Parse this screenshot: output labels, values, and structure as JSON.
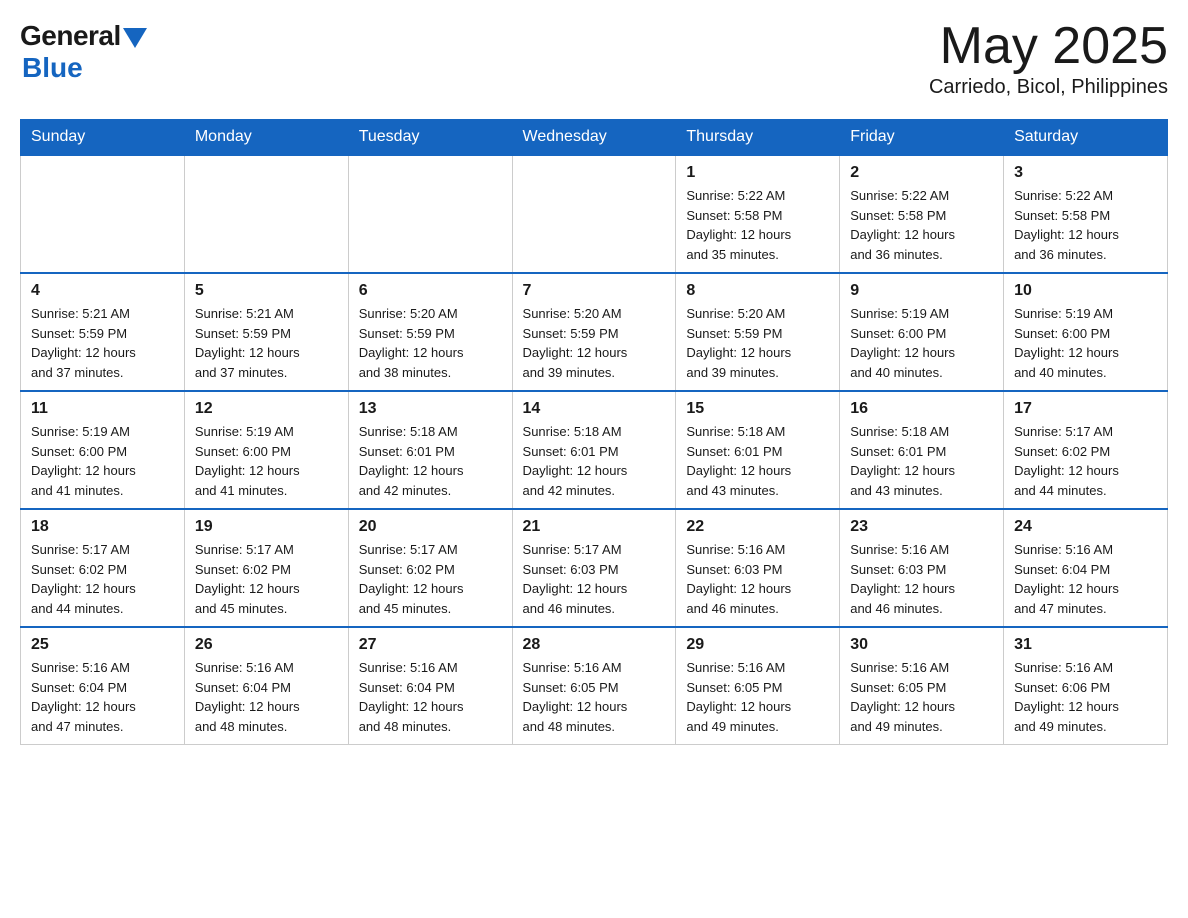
{
  "header": {
    "logo": {
      "general": "General",
      "blue": "Blue",
      "subtitle": "Blue"
    },
    "month": "May 2025",
    "location": "Carriedo, Bicol, Philippines"
  },
  "days_of_week": [
    "Sunday",
    "Monday",
    "Tuesday",
    "Wednesday",
    "Thursday",
    "Friday",
    "Saturday"
  ],
  "weeks": [
    {
      "days": [
        {
          "number": "",
          "info": ""
        },
        {
          "number": "",
          "info": ""
        },
        {
          "number": "",
          "info": ""
        },
        {
          "number": "",
          "info": ""
        },
        {
          "number": "1",
          "info": "Sunrise: 5:22 AM\nSunset: 5:58 PM\nDaylight: 12 hours\nand 35 minutes."
        },
        {
          "number": "2",
          "info": "Sunrise: 5:22 AM\nSunset: 5:58 PM\nDaylight: 12 hours\nand 36 minutes."
        },
        {
          "number": "3",
          "info": "Sunrise: 5:22 AM\nSunset: 5:58 PM\nDaylight: 12 hours\nand 36 minutes."
        }
      ]
    },
    {
      "days": [
        {
          "number": "4",
          "info": "Sunrise: 5:21 AM\nSunset: 5:59 PM\nDaylight: 12 hours\nand 37 minutes."
        },
        {
          "number": "5",
          "info": "Sunrise: 5:21 AM\nSunset: 5:59 PM\nDaylight: 12 hours\nand 37 minutes."
        },
        {
          "number": "6",
          "info": "Sunrise: 5:20 AM\nSunset: 5:59 PM\nDaylight: 12 hours\nand 38 minutes."
        },
        {
          "number": "7",
          "info": "Sunrise: 5:20 AM\nSunset: 5:59 PM\nDaylight: 12 hours\nand 39 minutes."
        },
        {
          "number": "8",
          "info": "Sunrise: 5:20 AM\nSunset: 5:59 PM\nDaylight: 12 hours\nand 39 minutes."
        },
        {
          "number": "9",
          "info": "Sunrise: 5:19 AM\nSunset: 6:00 PM\nDaylight: 12 hours\nand 40 minutes."
        },
        {
          "number": "10",
          "info": "Sunrise: 5:19 AM\nSunset: 6:00 PM\nDaylight: 12 hours\nand 40 minutes."
        }
      ]
    },
    {
      "days": [
        {
          "number": "11",
          "info": "Sunrise: 5:19 AM\nSunset: 6:00 PM\nDaylight: 12 hours\nand 41 minutes."
        },
        {
          "number": "12",
          "info": "Sunrise: 5:19 AM\nSunset: 6:00 PM\nDaylight: 12 hours\nand 41 minutes."
        },
        {
          "number": "13",
          "info": "Sunrise: 5:18 AM\nSunset: 6:01 PM\nDaylight: 12 hours\nand 42 minutes."
        },
        {
          "number": "14",
          "info": "Sunrise: 5:18 AM\nSunset: 6:01 PM\nDaylight: 12 hours\nand 42 minutes."
        },
        {
          "number": "15",
          "info": "Sunrise: 5:18 AM\nSunset: 6:01 PM\nDaylight: 12 hours\nand 43 minutes."
        },
        {
          "number": "16",
          "info": "Sunrise: 5:18 AM\nSunset: 6:01 PM\nDaylight: 12 hours\nand 43 minutes."
        },
        {
          "number": "17",
          "info": "Sunrise: 5:17 AM\nSunset: 6:02 PM\nDaylight: 12 hours\nand 44 minutes."
        }
      ]
    },
    {
      "days": [
        {
          "number": "18",
          "info": "Sunrise: 5:17 AM\nSunset: 6:02 PM\nDaylight: 12 hours\nand 44 minutes."
        },
        {
          "number": "19",
          "info": "Sunrise: 5:17 AM\nSunset: 6:02 PM\nDaylight: 12 hours\nand 45 minutes."
        },
        {
          "number": "20",
          "info": "Sunrise: 5:17 AM\nSunset: 6:02 PM\nDaylight: 12 hours\nand 45 minutes."
        },
        {
          "number": "21",
          "info": "Sunrise: 5:17 AM\nSunset: 6:03 PM\nDaylight: 12 hours\nand 46 minutes."
        },
        {
          "number": "22",
          "info": "Sunrise: 5:16 AM\nSunset: 6:03 PM\nDaylight: 12 hours\nand 46 minutes."
        },
        {
          "number": "23",
          "info": "Sunrise: 5:16 AM\nSunset: 6:03 PM\nDaylight: 12 hours\nand 46 minutes."
        },
        {
          "number": "24",
          "info": "Sunrise: 5:16 AM\nSunset: 6:04 PM\nDaylight: 12 hours\nand 47 minutes."
        }
      ]
    },
    {
      "days": [
        {
          "number": "25",
          "info": "Sunrise: 5:16 AM\nSunset: 6:04 PM\nDaylight: 12 hours\nand 47 minutes."
        },
        {
          "number": "26",
          "info": "Sunrise: 5:16 AM\nSunset: 6:04 PM\nDaylight: 12 hours\nand 48 minutes."
        },
        {
          "number": "27",
          "info": "Sunrise: 5:16 AM\nSunset: 6:04 PM\nDaylight: 12 hours\nand 48 minutes."
        },
        {
          "number": "28",
          "info": "Sunrise: 5:16 AM\nSunset: 6:05 PM\nDaylight: 12 hours\nand 48 minutes."
        },
        {
          "number": "29",
          "info": "Sunrise: 5:16 AM\nSunset: 6:05 PM\nDaylight: 12 hours\nand 49 minutes."
        },
        {
          "number": "30",
          "info": "Sunrise: 5:16 AM\nSunset: 6:05 PM\nDaylight: 12 hours\nand 49 minutes."
        },
        {
          "number": "31",
          "info": "Sunrise: 5:16 AM\nSunset: 6:06 PM\nDaylight: 12 hours\nand 49 minutes."
        }
      ]
    }
  ]
}
